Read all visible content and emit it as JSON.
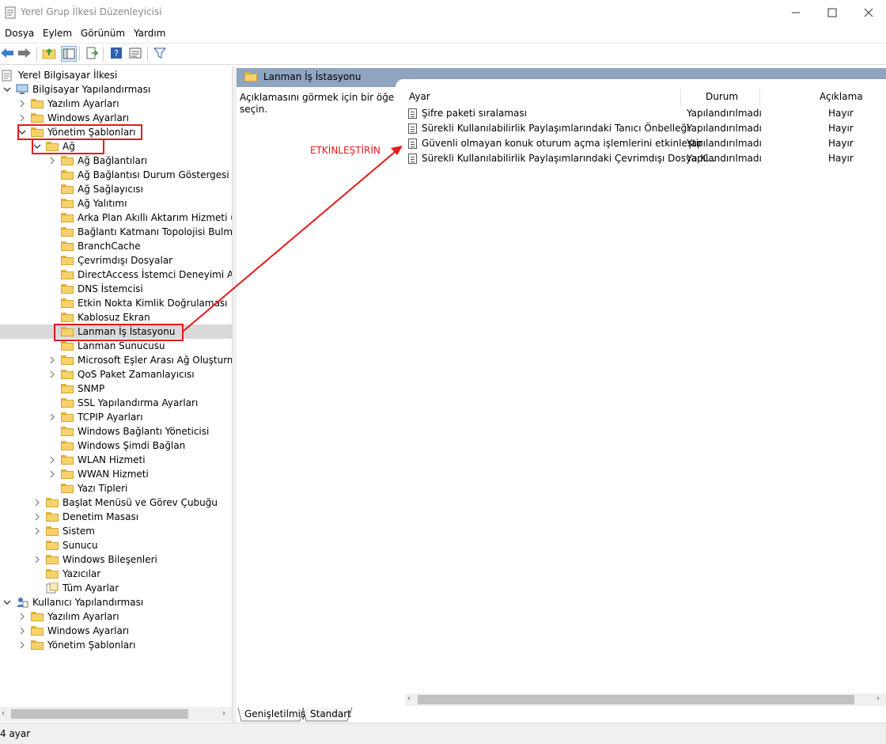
{
  "window": {
    "title": "Yerel Grup İlkesi Düzenleyicisi",
    "minimize": "—",
    "maximize": "☐",
    "close": "✕"
  },
  "menu": [
    "Dosya",
    "Eylem",
    "Görünüm",
    "Yardım"
  ],
  "tree": {
    "root": "Yerel Bilgisayar İlkesi",
    "computer_config": "Bilgisayar Yapılandırması",
    "cc_software": "Yazılım Ayarları",
    "cc_windows": "Windows Ayarları",
    "cc_admin": "Yönetim Şablonları",
    "network": "Ağ",
    "network_children": [
      "Ağ Bağlantıları",
      "Ağ Bağlantısı Durum Göstergesi",
      "Ağ Sağlayıcısı",
      "Ağ Yalıtımı",
      "Arka Plan Akıllı Aktarım Hizmeti (BITS)",
      "Bağlantı Katmanı Topolojisi Bulma",
      "BranchCache",
      "Çevrimdışı Dosyalar",
      "DirectAccess İstemci Deneyimi Ayarları",
      "DNS İstemcisi",
      "Etkin Nokta Kimlik Doğrulaması",
      "Kablosuz Ekran",
      "Lanman İş İstasyonu",
      "Lanman Sunucusu",
      "Microsoft Eşler Arası Ağ Oluşturma Hizmetleri",
      "QoS Paket Zamanlayıcısı",
      "SNMP",
      "SSL Yapılandırma Ayarları",
      "TCPIP Ayarları",
      "Windows Bağlantı Yöneticisi",
      "Windows Şimdi Bağlan",
      "WLAN Hizmeti",
      "WWAN Hizmeti",
      "Yazı Tipleri"
    ],
    "admin_siblings": [
      "Başlat Menüsü ve Görev Çubuğu",
      "Denetim Masası",
      "Sistem",
      "Sunucu",
      "Windows Bileşenleri",
      "Yazıcılar",
      "Tüm Ayarlar"
    ],
    "user_config": "Kullanıcı Yapılandırması",
    "uc_children": [
      "Yazılım Ayarları",
      "Windows Ayarları",
      "Yönetim Şablonları"
    ]
  },
  "right": {
    "header": "Lanman İş İstasyonu",
    "description": "Açıklamasını görmek için bir öğe seçin.",
    "columns": {
      "setting": "Ayar",
      "state": "Durum",
      "comment": "Açıklama"
    },
    "rows": [
      {
        "setting": "Şifre paketi sıralaması",
        "state": "Yapılandırılmadı",
        "comment": "Hayır"
      },
      {
        "setting": "Sürekli Kullanılabilirlik Paylaşımlarındaki Tanıcı Önbelleği",
        "state": "Yapılandırılmadı",
        "comment": "Hayır"
      },
      {
        "setting": "Güvenli olmayan konuk oturum açma işlemlerini etkinleştir",
        "state": "Yapılandırılmadı",
        "comment": "Hayır"
      },
      {
        "setting": "Sürekli Kullanılabilirlik Paylaşımlarındaki Çevrimdışı Dosya K...",
        "state": "Yapılandırılmadı",
        "comment": "Hayır"
      }
    ]
  },
  "annotation": "ETKİNLEŞTİRİN",
  "tabs": [
    "Genişletilmiş",
    "Standart"
  ],
  "status": "4 ayar",
  "colors": {
    "highlight": "#e8191c",
    "header_bar": "#8ea4bf",
    "folder": "#f6d36a"
  }
}
